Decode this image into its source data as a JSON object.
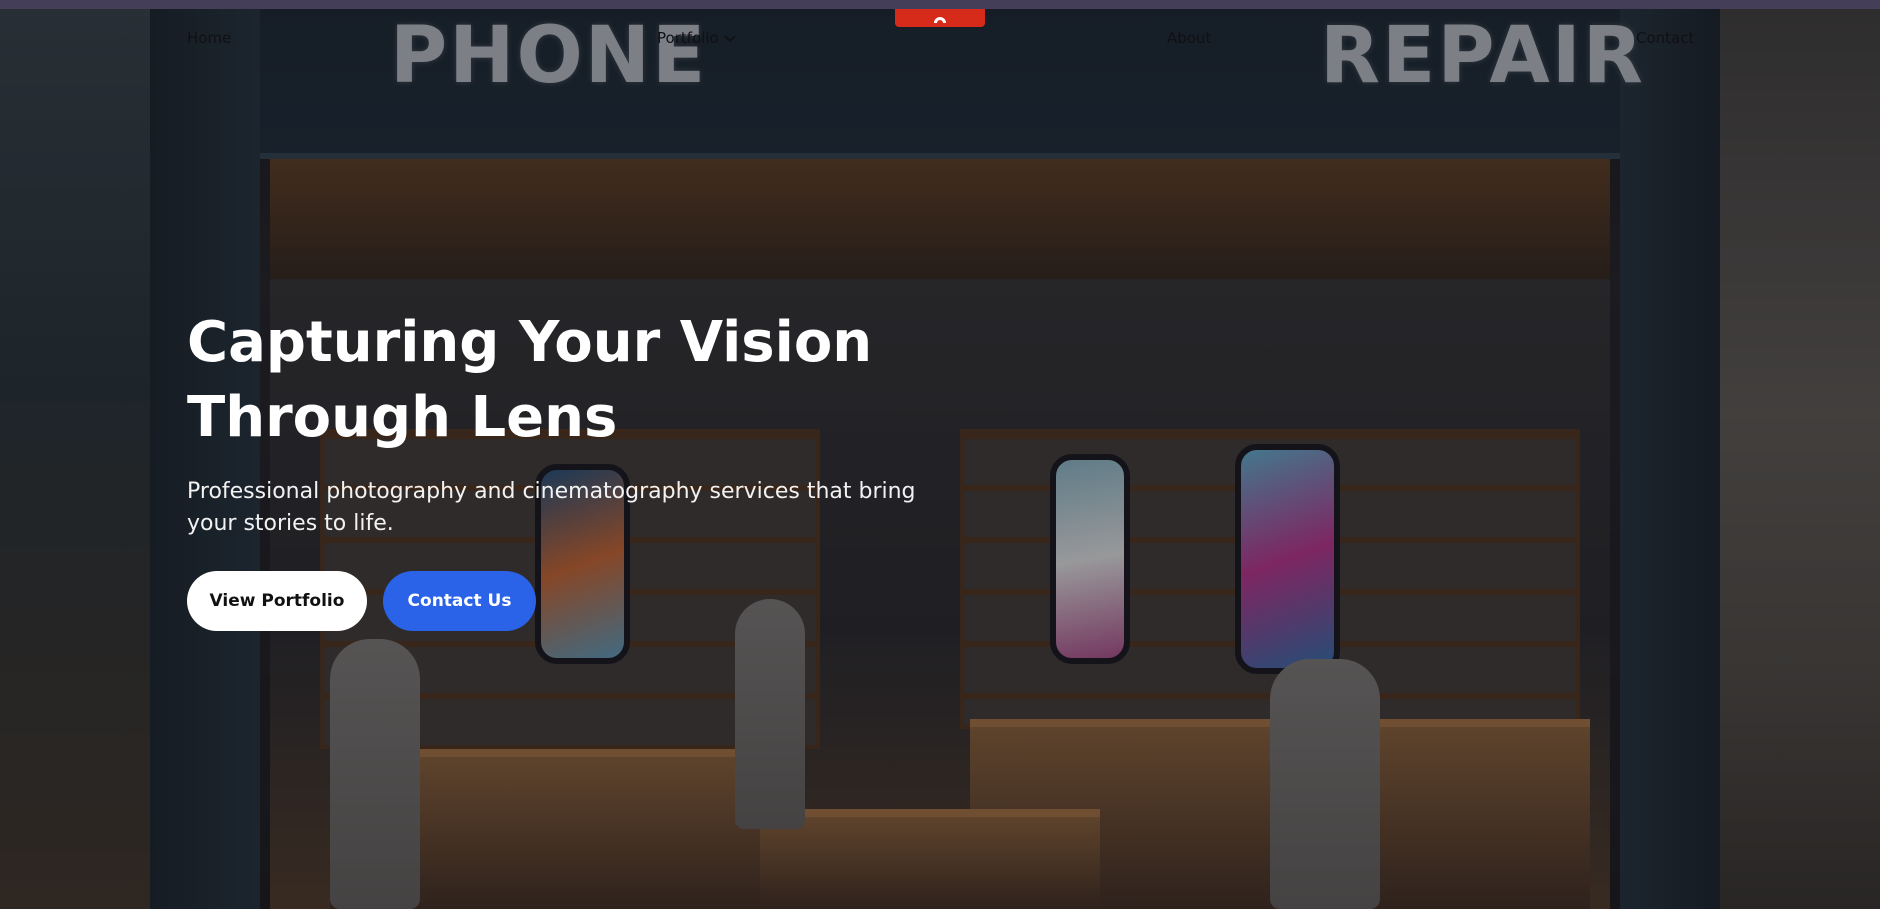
{
  "nav": {
    "home_label": "Home",
    "portfolio_label": "Portfolio",
    "about_label": "About",
    "contact_label": "Contact"
  },
  "hero": {
    "background_sign_left": "PHONE",
    "background_sign_right": "REPAIR",
    "title_line1": "Capturing Your Vision",
    "title_line2": "Through Lens",
    "subtitle": "Professional photography and cinematography services that bring your stories to life.",
    "primary_button_label": "View Portfolio",
    "secondary_button_label": "Contact Us"
  },
  "colors": {
    "top_strip": "#443e58",
    "logo_accent": "#d62a1a",
    "primary_button_bg": "#ffffff",
    "secondary_button_bg": "#2a62e8"
  }
}
